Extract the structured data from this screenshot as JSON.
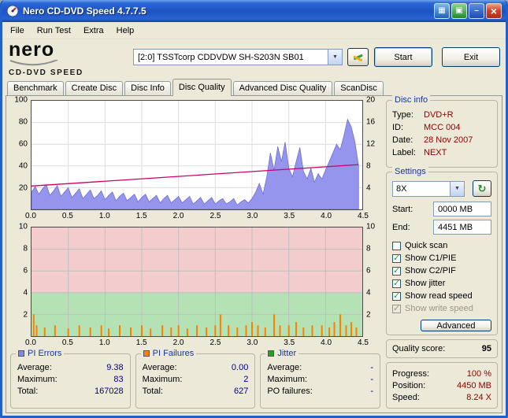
{
  "window": {
    "title": "Nero CD-DVD Speed 4.7.7.5",
    "menu": [
      "File",
      "Run Test",
      "Extra",
      "Help"
    ]
  },
  "icons": {
    "dropdown_arrow": "▼",
    "refresh": "↻",
    "window_button_1": "▦",
    "window_button_2": "▣",
    "minimize": "–",
    "close": "×",
    "check": "✓"
  },
  "logo": {
    "line1": "nero",
    "line2": "CD-DVD SPEED"
  },
  "header": {
    "drive_selector": {
      "value": "[2:0]   TSSTcorp CDDVDW SH-S203N SB01"
    },
    "start_button": "Start",
    "exit_button": "Exit"
  },
  "tabs": [
    {
      "label": "Benchmark",
      "active": false
    },
    {
      "label": "Create Disc",
      "active": false
    },
    {
      "label": "Disc Info",
      "active": false
    },
    {
      "label": "Disc Quality",
      "active": true
    },
    {
      "label": "Advanced Disc Quality",
      "active": false
    },
    {
      "label": "ScanDisc",
      "active": false
    }
  ],
  "disc_info": {
    "title": "Disc info",
    "rows": [
      {
        "label": "Type:",
        "value": "DVD+R"
      },
      {
        "label": "ID:",
        "value": "MCC 004"
      },
      {
        "label": "Date:",
        "value": "28 Nov 2007"
      },
      {
        "label": "Label:",
        "value": "NEXT"
      }
    ]
  },
  "settings": {
    "title": "Settings",
    "speed_value": "8X",
    "start_label": "Start:",
    "start_value": "0000 MB",
    "end_label": "End:",
    "end_value": "4451 MB",
    "checkboxes": [
      {
        "label": "Quick scan",
        "checked": false,
        "disabled": false
      },
      {
        "label": "Show C1/PIE",
        "checked": true,
        "disabled": false
      },
      {
        "label": "Show C2/PIF",
        "checked": true,
        "disabled": false
      },
      {
        "label": "Show jitter",
        "checked": true,
        "disabled": false
      },
      {
        "label": "Show read speed",
        "checked": true,
        "disabled": false
      },
      {
        "label": "Show write speed",
        "checked": true,
        "disabled": true
      }
    ],
    "advanced_button": "Advanced"
  },
  "quality": {
    "label": "Quality score:",
    "value": "95"
  },
  "status": {
    "rows": [
      {
        "label": "Progress:",
        "value": "100 %"
      },
      {
        "label": "Position:",
        "value": "4450 MB"
      },
      {
        "label": "Speed:",
        "value": "8.24 X"
      }
    ]
  },
  "pi_errors_panel": {
    "title": "PI Errors",
    "swatch": "#8585ee",
    "rows": [
      {
        "label": "Average:",
        "value": "9.38"
      },
      {
        "label": "Maximum:",
        "value": "83"
      },
      {
        "label": "Total:",
        "value": "167028"
      }
    ]
  },
  "pi_failures_panel": {
    "title": "PI Failures",
    "swatch": "#ff8000",
    "rows": [
      {
        "label": "Average:",
        "value": "0.00"
      },
      {
        "label": "Maximum:",
        "value": "2"
      },
      {
        "label": "Total:",
        "value": "627"
      }
    ]
  },
  "jitter_panel": {
    "title": "Jitter",
    "swatch": "#18a818",
    "rows": [
      {
        "label": "Average:",
        "value": "-"
      },
      {
        "label": "Maximum:",
        "value": "-"
      },
      {
        "label": "PO failures:",
        "value": "-"
      }
    ]
  },
  "colors": {
    "value_navy": "#00008b",
    "value_maroon": "#8b0000",
    "group_title_blue": "#16379c",
    "pi_area_fill": "#9595ee",
    "read_speed_line": "#cc0066",
    "pif_bars": "#ff8000",
    "zone_green": "#b5e2b5",
    "zone_pink": "#f3cdcd"
  },
  "chart_data": [
    {
      "type": "area",
      "name": "pi-errors-chart",
      "title": "PI Errors vs position (GB) with read speed overlay",
      "xlim": [
        0,
        4.5
      ],
      "ylim_left": [
        0,
        100
      ],
      "ylim_right": [
        0,
        20
      ],
      "x_ticks": [
        "0.0",
        "0.5",
        "1.0",
        "1.5",
        "2.0",
        "2.5",
        "3.0",
        "3.5",
        "4.0",
        "4.5"
      ],
      "y_ticks_left": [
        100,
        80,
        60,
        40,
        20
      ],
      "y_ticks_right": [
        20,
        16,
        12,
        8,
        4
      ],
      "grid_x": [
        0.5,
        1.0,
        1.5,
        2.0,
        2.5,
        3.0,
        3.5,
        4.0
      ],
      "grid_y": [
        20,
        40,
        60,
        80
      ],
      "grid_color": "#dcdcdc",
      "legend": "off",
      "series": [
        {
          "name": "PI Errors",
          "render": "area",
          "axis": "left",
          "color": "#9595ee",
          "stroke": "#6666cc",
          "x_start": 0,
          "x_step": 0.05,
          "y": [
            16,
            21,
            14,
            19,
            23,
            13,
            17,
            22,
            12,
            16,
            20,
            11,
            15,
            19,
            10,
            14,
            18,
            10,
            13,
            17,
            9,
            13,
            16,
            8,
            12,
            15,
            8,
            11,
            14,
            7,
            11,
            14,
            7,
            10,
            13,
            6,
            10,
            13,
            6,
            9,
            12,
            6,
            9,
            12,
            5,
            8,
            11,
            5,
            8,
            11,
            5,
            8,
            10,
            5,
            7,
            10,
            4,
            7,
            9,
            6,
            10,
            16,
            24,
            14,
            30,
            52,
            36,
            58,
            44,
            62,
            38,
            30,
            44,
            57,
            35,
            28,
            38,
            25,
            33,
            28,
            36,
            44,
            52,
            60,
            55,
            68,
            83,
            76,
            62,
            40
          ]
        },
        {
          "name": "Read speed (X)",
          "render": "line",
          "axis": "right",
          "color": "#cc0066",
          "x": [
            0,
            4.45
          ],
          "y": [
            4.3,
            8.24
          ]
        }
      ]
    },
    {
      "type": "bar",
      "name": "pi-failures-chart",
      "title": "PI Failures vs position (GB)",
      "xlim": [
        0,
        4.5
      ],
      "ylim_left": [
        0,
        10
      ],
      "ylim_right": [
        0,
        10
      ],
      "x_ticks": [
        "0.0",
        "0.5",
        "1.0",
        "1.5",
        "2.0",
        "2.5",
        "3.0",
        "3.5",
        "4.0",
        "4.5"
      ],
      "y_ticks_left": [
        10,
        8,
        6,
        4,
        2
      ],
      "y_ticks_right": [
        10,
        8,
        6,
        4,
        2
      ],
      "grid_x": [
        0.5,
        1.0,
        1.5,
        2.0,
        2.5,
        3.0,
        3.5,
        4.0
      ],
      "grid_y": [
        2,
        4,
        6,
        8
      ],
      "grid_color": "#bfbfbf",
      "legend": "off",
      "zones": [
        {
          "from": 0,
          "to": 4,
          "color": "#b5e2b5"
        },
        {
          "from": 4,
          "to": 10,
          "color": "#f3cdcd"
        }
      ],
      "series": [
        {
          "name": "PI Failures",
          "render": "bars",
          "axis": "left",
          "color": "#ff8000",
          "points": [
            [
              0.03,
              2
            ],
            [
              0.07,
              1
            ],
            [
              0.18,
              0.8
            ],
            [
              0.32,
              1
            ],
            [
              0.5,
              0.7
            ],
            [
              0.65,
              1
            ],
            [
              0.8,
              0.8
            ],
            [
              0.95,
              1
            ],
            [
              1.05,
              0.7
            ],
            [
              1.2,
              1
            ],
            [
              1.35,
              0.8
            ],
            [
              1.5,
              1
            ],
            [
              1.62,
              0.7
            ],
            [
              1.78,
              1
            ],
            [
              1.9,
              0.8
            ],
            [
              2.0,
              1
            ],
            [
              2.12,
              0.7
            ],
            [
              2.25,
              1
            ],
            [
              2.38,
              0.8
            ],
            [
              2.5,
              1
            ],
            [
              2.57,
              2
            ],
            [
              2.68,
              1
            ],
            [
              2.8,
              0.8
            ],
            [
              2.92,
              1
            ],
            [
              3.0,
              1.3
            ],
            [
              3.08,
              1
            ],
            [
              3.18,
              0.8
            ],
            [
              3.3,
              2
            ],
            [
              3.38,
              1
            ],
            [
              3.5,
              1
            ],
            [
              3.6,
              1.3
            ],
            [
              3.7,
              0.8
            ],
            [
              3.82,
              1
            ],
            [
              3.95,
              1
            ],
            [
              4.05,
              0.8
            ],
            [
              4.12,
              1.3
            ],
            [
              4.2,
              2
            ],
            [
              4.28,
              1
            ],
            [
              4.35,
              1.3
            ],
            [
              4.42,
              0.8
            ]
          ]
        }
      ]
    }
  ]
}
